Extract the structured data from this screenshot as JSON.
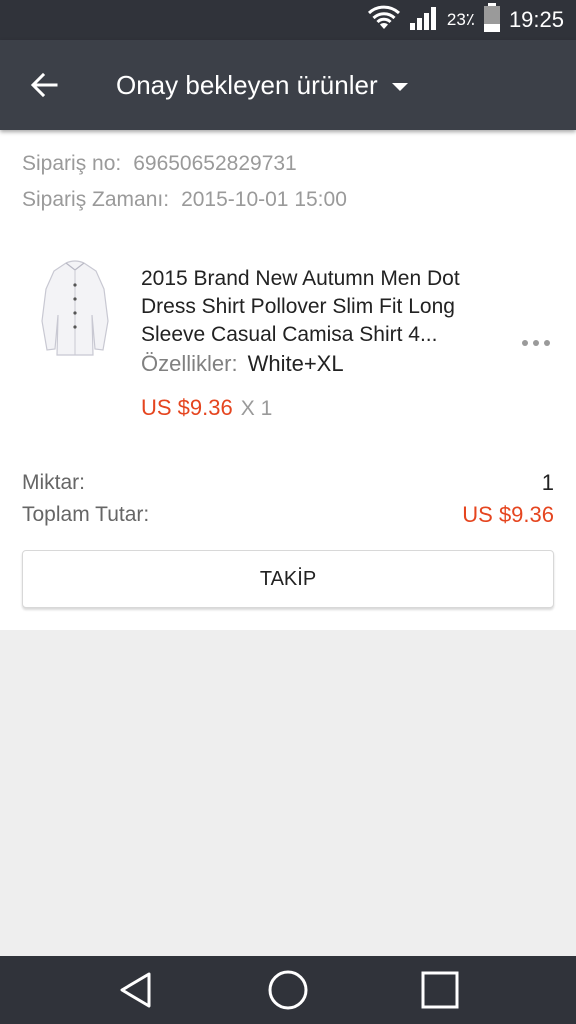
{
  "status_bar": {
    "battery_text": "23٪",
    "time": "19:25",
    "icons": [
      "wifi-icon",
      "signal-icon",
      "battery-icon"
    ]
  },
  "app_bar": {
    "title": "Onay bekleyen ürünler",
    "icons": [
      "back-arrow-icon",
      "caret-down-icon"
    ]
  },
  "order": {
    "number_label": "Sipariş no:",
    "number_value": "69650652829731",
    "time_label": "Sipariş Zamanı:",
    "time_value": "2015-10-01 15:00"
  },
  "product": {
    "title": "2015 Brand New Autumn Men Dot Dress Shirt Pollover Slim Fit Long Sleeve Casual Camisa Shirt 4...",
    "props_label": "Özellikler:",
    "props_value": "White+XL",
    "price": "US $9.36",
    "qty": "X 1",
    "image_icon": "white-shirt-image",
    "more_icon": "more-dots-icon"
  },
  "summary": {
    "quantity_label": "Miktar:",
    "quantity_value": "1",
    "total_label": "Toplam Tutar:",
    "total_value": "US $9.36"
  },
  "actions": {
    "track_label": "TAKİP"
  },
  "nav_bar": {
    "icons": [
      "back-triangle-icon",
      "home-circle-icon",
      "recents-square-icon"
    ]
  },
  "colors": {
    "status_bar": "#30333a",
    "app_bar": "#3c4048",
    "price": "#e5451f",
    "background": "#eeeeee"
  }
}
